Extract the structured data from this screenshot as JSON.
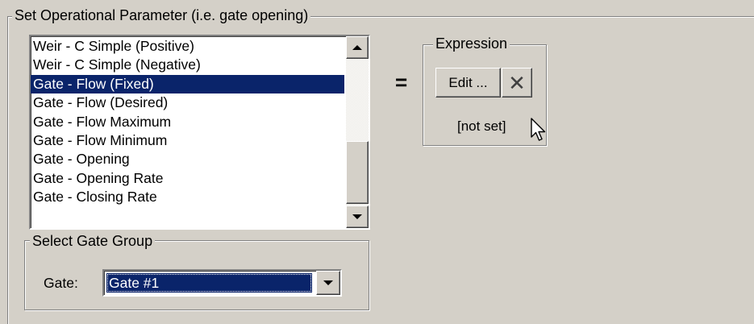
{
  "operational_group": {
    "title": "Set Operational Parameter (i.e. gate opening)"
  },
  "parameter_list": {
    "items": [
      "Weir - C Simple (Positive)",
      "Weir - C Simple (Negative)",
      "Gate - Flow (Fixed)",
      "Gate - Flow (Desired)",
      "Gate - Flow Maximum",
      "Gate - Flow Minimum",
      "Gate - Opening",
      "Gate - Opening Rate",
      "Gate - Closing Rate"
    ],
    "selected": "Gate - Flow (Fixed)",
    "icons": {
      "scroll_up": "up-arrow-icon",
      "scroll_down": "down-arrow-icon"
    }
  },
  "equals_sign": "=",
  "expression": {
    "title": "Expression",
    "edit_label": "Edit ...",
    "clear_label": "✕",
    "status": "[not set]"
  },
  "gate_group": {
    "title": "Select Gate Group",
    "gate_label": "Gate:",
    "selected_gate": "Gate #1",
    "dropdown_icon": "chevron-down-icon"
  },
  "colors": {
    "window_bg": "#d4d0c8",
    "selection_bg": "#0a246a",
    "selection_text": "#ffffff"
  }
}
